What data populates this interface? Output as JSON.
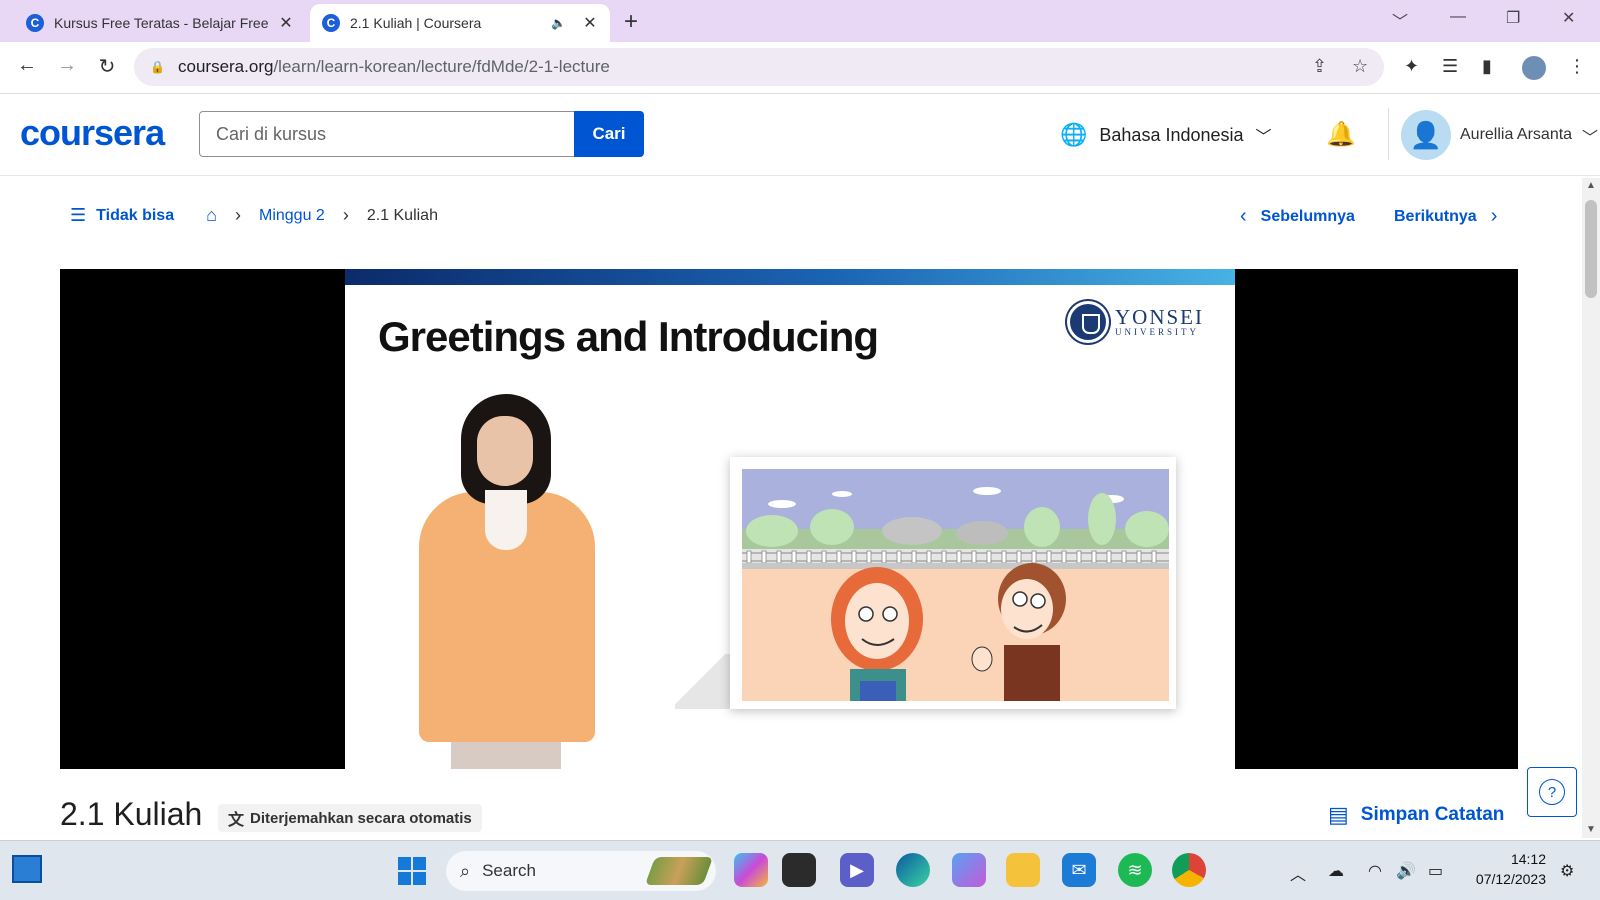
{
  "browser": {
    "tabs": [
      {
        "title": "Kursus Free Teratas - Belajar Free",
        "active": false
      },
      {
        "title": "2.1 Kuliah | Coursera",
        "active": true
      }
    ],
    "url_host": "coursera.org",
    "url_path": "/learn/learn-korean/lecture/fdMde/2-1-lecture"
  },
  "header": {
    "logo": "coursera",
    "search_placeholder": "Cari di kursus",
    "search_button": "Cari",
    "language": "Bahasa Indonesia",
    "user_name": "Aurellia Arsanta"
  },
  "nav": {
    "menu_toggle": "Tidak bisa",
    "breadcrumb_week": "Minggu 2",
    "breadcrumb_current": "2.1 Kuliah",
    "previous": "Sebelumnya",
    "next": "Berikutnya"
  },
  "video": {
    "slide_title": "Greetings and Introducing",
    "logo_line1": "YONSEI",
    "logo_line2": "UNIVERSITY"
  },
  "lecture": {
    "title": "2.1 Kuliah",
    "auto_translated": "Diterjemahkan secara otomatis",
    "save_notes": "Simpan Catatan",
    "help": "?"
  },
  "taskbar": {
    "search_label": "Search",
    "time": "14:12",
    "date": "07/12/2023"
  },
  "colors": {
    "brand_blue": "#0056d2",
    "tab_strip": "#e8d8f6"
  }
}
